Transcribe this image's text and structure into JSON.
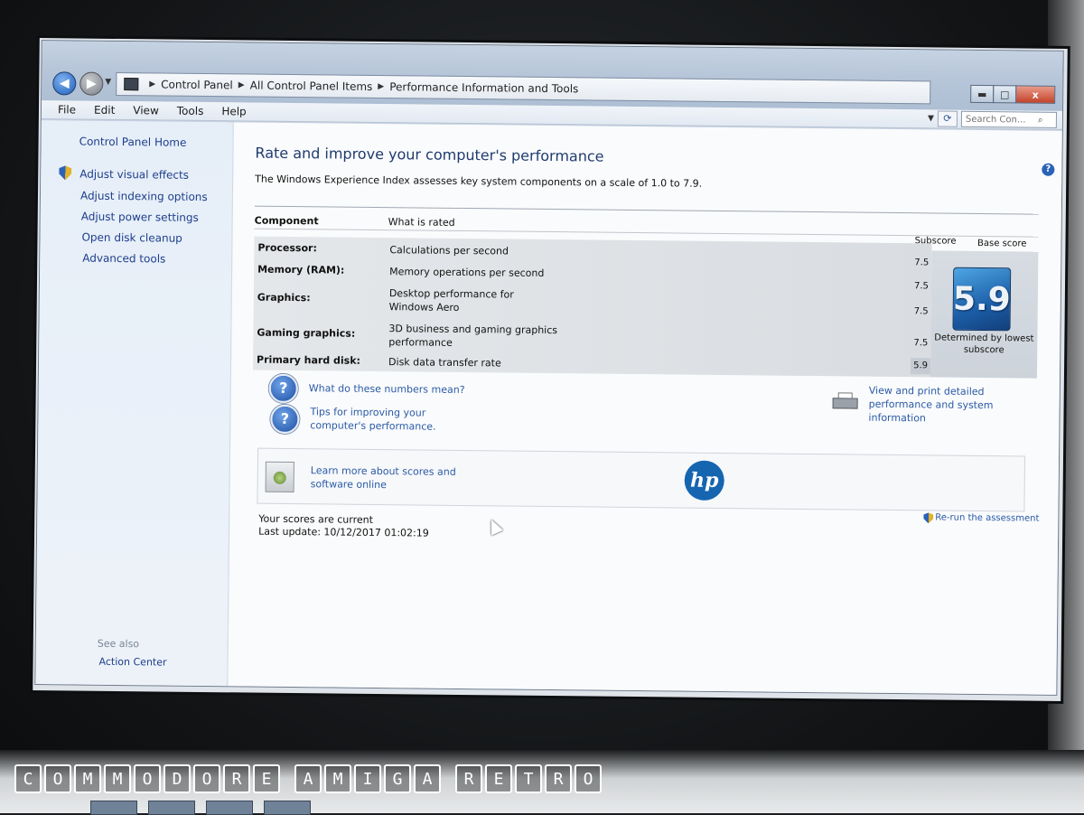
{
  "window": {
    "breadcrumbs": [
      "Control Panel",
      "All Control Panel Items",
      "Performance Information and Tools"
    ],
    "controls": {
      "minimize": "▬",
      "maximize": "□",
      "close": "x"
    }
  },
  "menu": {
    "items": [
      "File",
      "Edit",
      "View",
      "Tools",
      "Help"
    ],
    "search_placeholder": "Search Con..."
  },
  "sidebar": {
    "home": "Control Panel Home",
    "links": [
      "Adjust visual effects",
      "Adjust indexing options",
      "Adjust power settings",
      "Open disk cleanup",
      "Advanced tools"
    ],
    "see_also_heading": "See also",
    "see_also_links": [
      "Action Center"
    ]
  },
  "main": {
    "title": "Rate and improve your computer's performance",
    "description": "The Windows Experience Index assesses key system components on a scale of 1.0 to 7.9.",
    "table": {
      "headers": {
        "component": "Component",
        "what": "What is rated",
        "subscore": "Subscore",
        "base": "Base score"
      },
      "rows": [
        {
          "component": "Processor:",
          "what": "Calculations per second",
          "subscore": "7.5"
        },
        {
          "component": "Memory (RAM):",
          "what": "Memory operations per second",
          "subscore": "7.5"
        },
        {
          "component": "Graphics:",
          "what": "Desktop performance for Windows Aero",
          "subscore": "7.5"
        },
        {
          "component": "Gaming graphics:",
          "what": "3D business and gaming graphics performance",
          "subscore": "7.5"
        },
        {
          "component": "Primary hard disk:",
          "what": "Disk data transfer rate",
          "subscore": "5.9"
        }
      ],
      "base_score": "5.9",
      "base_caption": "Determined by lowest subscore"
    },
    "help_links": [
      "What do these numbers mean?",
      "Tips for improving your computer's performance."
    ],
    "print_link": "View and print detailed performance and system information",
    "learn_link": "Learn more about scores and software online",
    "hp_logo": "hp",
    "status_line": "Your scores are current",
    "last_update": "Last update: 10/12/2017 01:02:19",
    "rerun_link": "Re-run the assessment"
  },
  "watermark": [
    "C",
    "O",
    "M",
    "M",
    "O",
    "D",
    "O",
    "R",
    "E",
    " ",
    "A",
    "M",
    "I",
    "G",
    "A",
    " ",
    "R",
    "E",
    "T",
    "R",
    "O"
  ],
  "colors": {
    "link": "#2a5aa6",
    "title": "#1e3a6e",
    "base_tile": "#1c5ea8",
    "close_button": "#c4432a"
  }
}
